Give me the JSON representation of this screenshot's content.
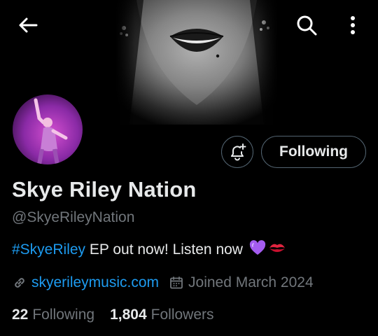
{
  "header": {
    "back_icon": "arrow-left-icon",
    "search_icon": "search-icon",
    "more_icon": "more-vertical-icon"
  },
  "profile": {
    "display_name": "Skye Riley Nation",
    "handle": "@SkyeRileyNation",
    "bio": {
      "hashtag": "#SkyeRiley",
      "text": " EP out now! Listen now ",
      "emojis": [
        "purple-heart",
        "kiss-mark"
      ]
    },
    "website": "skyerileymusic.com",
    "joined": "Joined March 2024",
    "following_count": "22",
    "following_label": "Following",
    "followers_count": "1,804",
    "followers_label": "Followers"
  },
  "actions": {
    "notify_icon": "bell-plus-icon",
    "follow_state_label": "Following"
  },
  "colors": {
    "background": "#000000",
    "text_primary": "#e7e9ea",
    "text_secondary": "#71767b",
    "link": "#1d9bf0",
    "border": "#536471"
  }
}
